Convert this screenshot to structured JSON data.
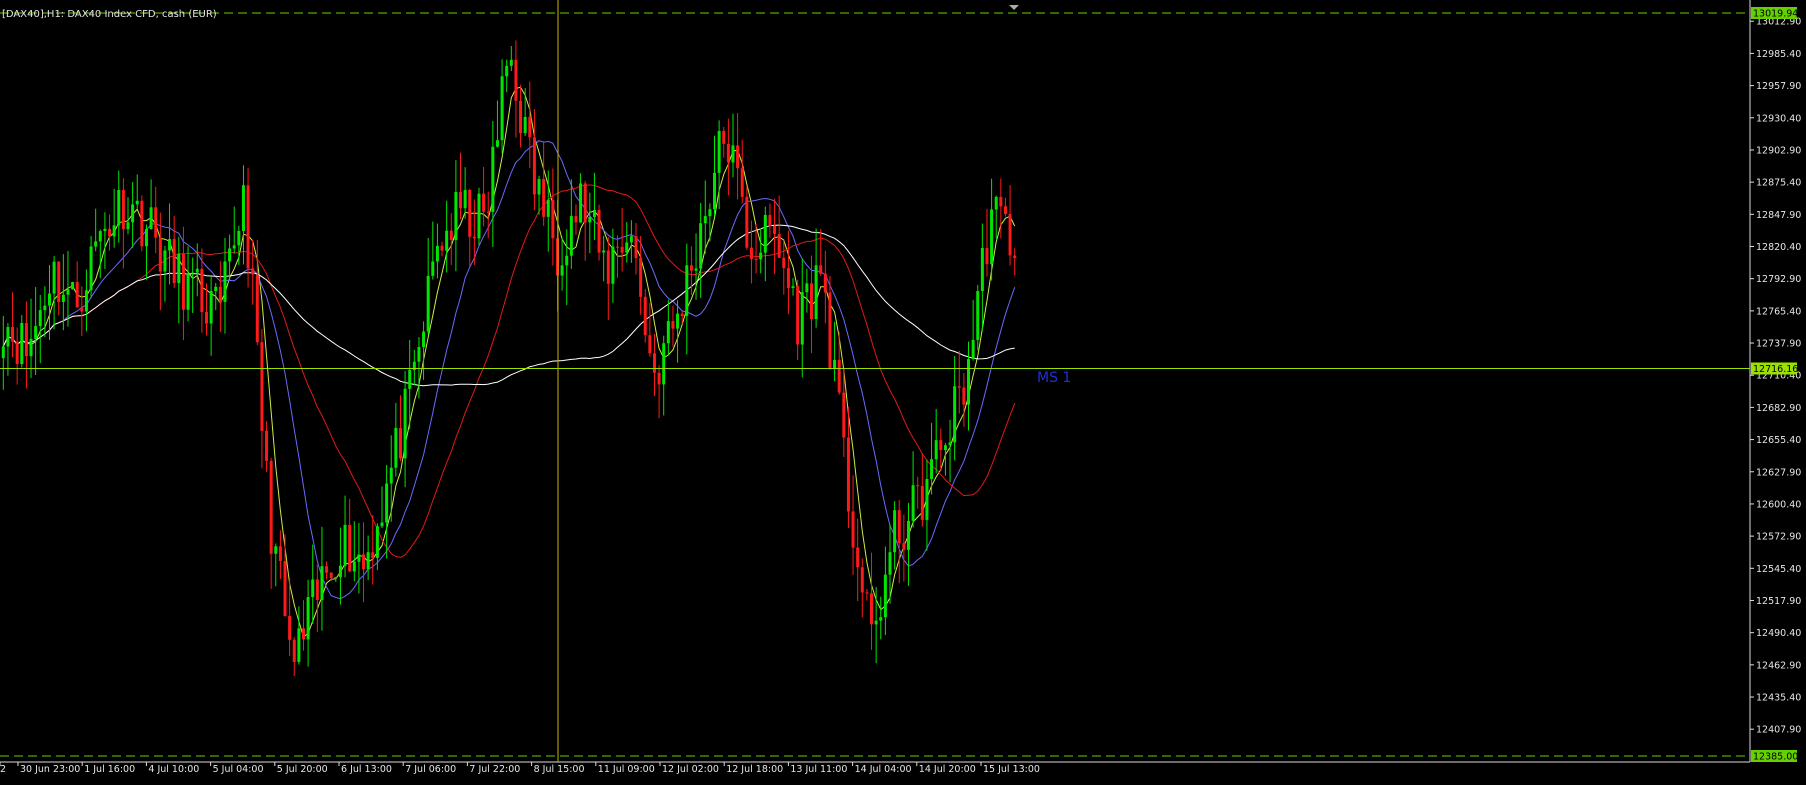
{
  "window": {
    "symbol_title": "[DAX40],H1: DAX40 Index CFD, cash (EUR)"
  },
  "colors": {
    "background": "#000000",
    "bull_candle": "#00e600",
    "bear_candle": "#ff1a1a",
    "ma_fast": "#ccee44",
    "ma_blue": "#6a6aff",
    "ma_red": "#e01a1a",
    "ma_white": "#ffffff",
    "crosshair_vertical": "#c8b400",
    "level_line": "#9be000",
    "dashed_line": "#64d000",
    "axis_text": "#e6e6e6"
  },
  "chart_data": {
    "type": "candlestick",
    "title": "[DAX40],H1: DAX40 Index CFD, cash (EUR)",
    "timeframe": "H1",
    "ylim": [
      12385.0,
      13019.94
    ],
    "y_ticks": [
      "13012.90",
      "12985.40",
      "12957.90",
      "12930.40",
      "12902.90",
      "12875.40",
      "12847.90",
      "12820.40",
      "12792.90",
      "12765.40",
      "12737.90",
      "12710.40",
      "12682.90",
      "12655.40",
      "12627.90",
      "12600.40",
      "12572.90",
      "12545.40",
      "12517.90",
      "12490.40",
      "12462.90",
      "12435.40",
      "12407.90"
    ],
    "x_ticks": [
      "2",
      "30 Jun 23:00",
      "1 Jul 16:00",
      "4 Jul 10:00",
      "5 Jul 04:00",
      "5 Jul 20:00",
      "6 Jul 13:00",
      "7 Jul 06:00",
      "7 Jul 22:00",
      "8 Jul 15:00",
      "11 Jul 09:00",
      "12 Jul 02:00",
      "12 Jul 18:00",
      "13 Jul 11:00",
      "14 Jul 04:00",
      "14 Jul 20:00",
      "15 Jul 13:00"
    ],
    "price_badges": {
      "top": "13019.94",
      "level": "12716.16",
      "bottom": "12385.00"
    },
    "horizontal_level": 12716.16,
    "annotation": "MS 1",
    "key_points": [
      12760,
      12730,
      12800,
      12770,
      12830,
      12860,
      12840,
      12800,
      12780,
      12760,
      12870,
      12600,
      12460,
      12520,
      12570,
      12550,
      12620,
      12700,
      12820,
      12850,
      12840,
      12990,
      12880,
      12820,
      12860,
      12800,
      12840,
      12710,
      12760,
      12840,
      12920,
      12820,
      12830,
      12760,
      12800,
      12620,
      12480,
      12570,
      12600,
      12650,
      12710,
      12850,
      12825
    ],
    "moving_averages": [
      {
        "color": "ma_fast"
      },
      {
        "color": "ma_blue"
      },
      {
        "color": "ma_red"
      },
      {
        "color": "ma_white"
      }
    ],
    "grid": false
  }
}
